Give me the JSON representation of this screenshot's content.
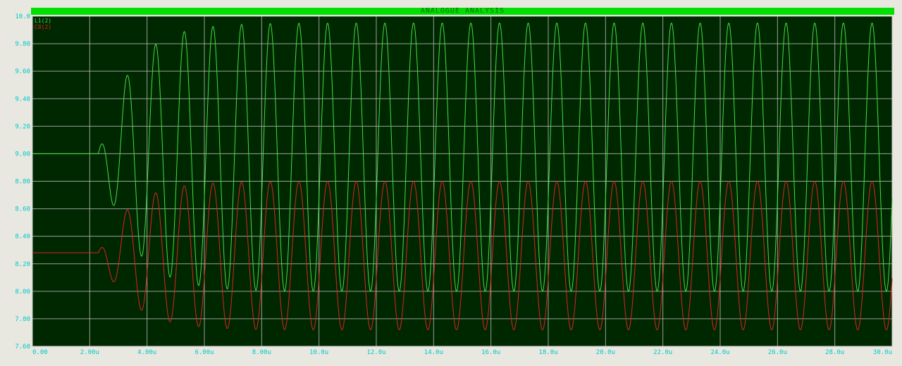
{
  "window": {
    "title": "ANALOGUE ANALYSIS"
  },
  "colors": {
    "plot_bg": "#002800",
    "grid": "#c8c8c8",
    "axis_text": "#00c8c8",
    "title_bar": "#00e000",
    "series_green": "#44dd44",
    "series_red": "#dd2222"
  },
  "chart_data": {
    "type": "line",
    "title": "ANALOGUE ANALYSIS",
    "xlabel": "",
    "ylabel": "",
    "xlim": [
      0,
      30
    ],
    "ylim": [
      7.6,
      10.0
    ],
    "grid": true,
    "legend_position": "top-left",
    "x_ticks": [
      "0.00",
      "2.00u",
      "4.00u",
      "6.00u",
      "8.00u",
      "10.0u",
      "12.0u",
      "14.0u",
      "16.0u",
      "18.0u",
      "20.0u",
      "22.0u",
      "24.0u",
      "26.0u",
      "28.0u",
      "30.0u"
    ],
    "y_ticks": [
      "7.60",
      "7.80",
      "8.00",
      "8.20",
      "8.40",
      "8.60",
      "8.80",
      "9.00",
      "9.20",
      "9.40",
      "9.60",
      "9.80",
      "10.0"
    ],
    "series": [
      {
        "name": "L1(2)",
        "color": "#44dd44",
        "baseline": 9.0,
        "onset_us": 2.3,
        "steady_max": 9.95,
        "steady_min": 8.0,
        "period_us": 1.0
      },
      {
        "name": "C8(2)",
        "color": "#dd2222",
        "baseline": 8.28,
        "onset_us": 2.3,
        "steady_max": 8.8,
        "steady_min": 7.72,
        "period_us": 1.0
      }
    ]
  }
}
